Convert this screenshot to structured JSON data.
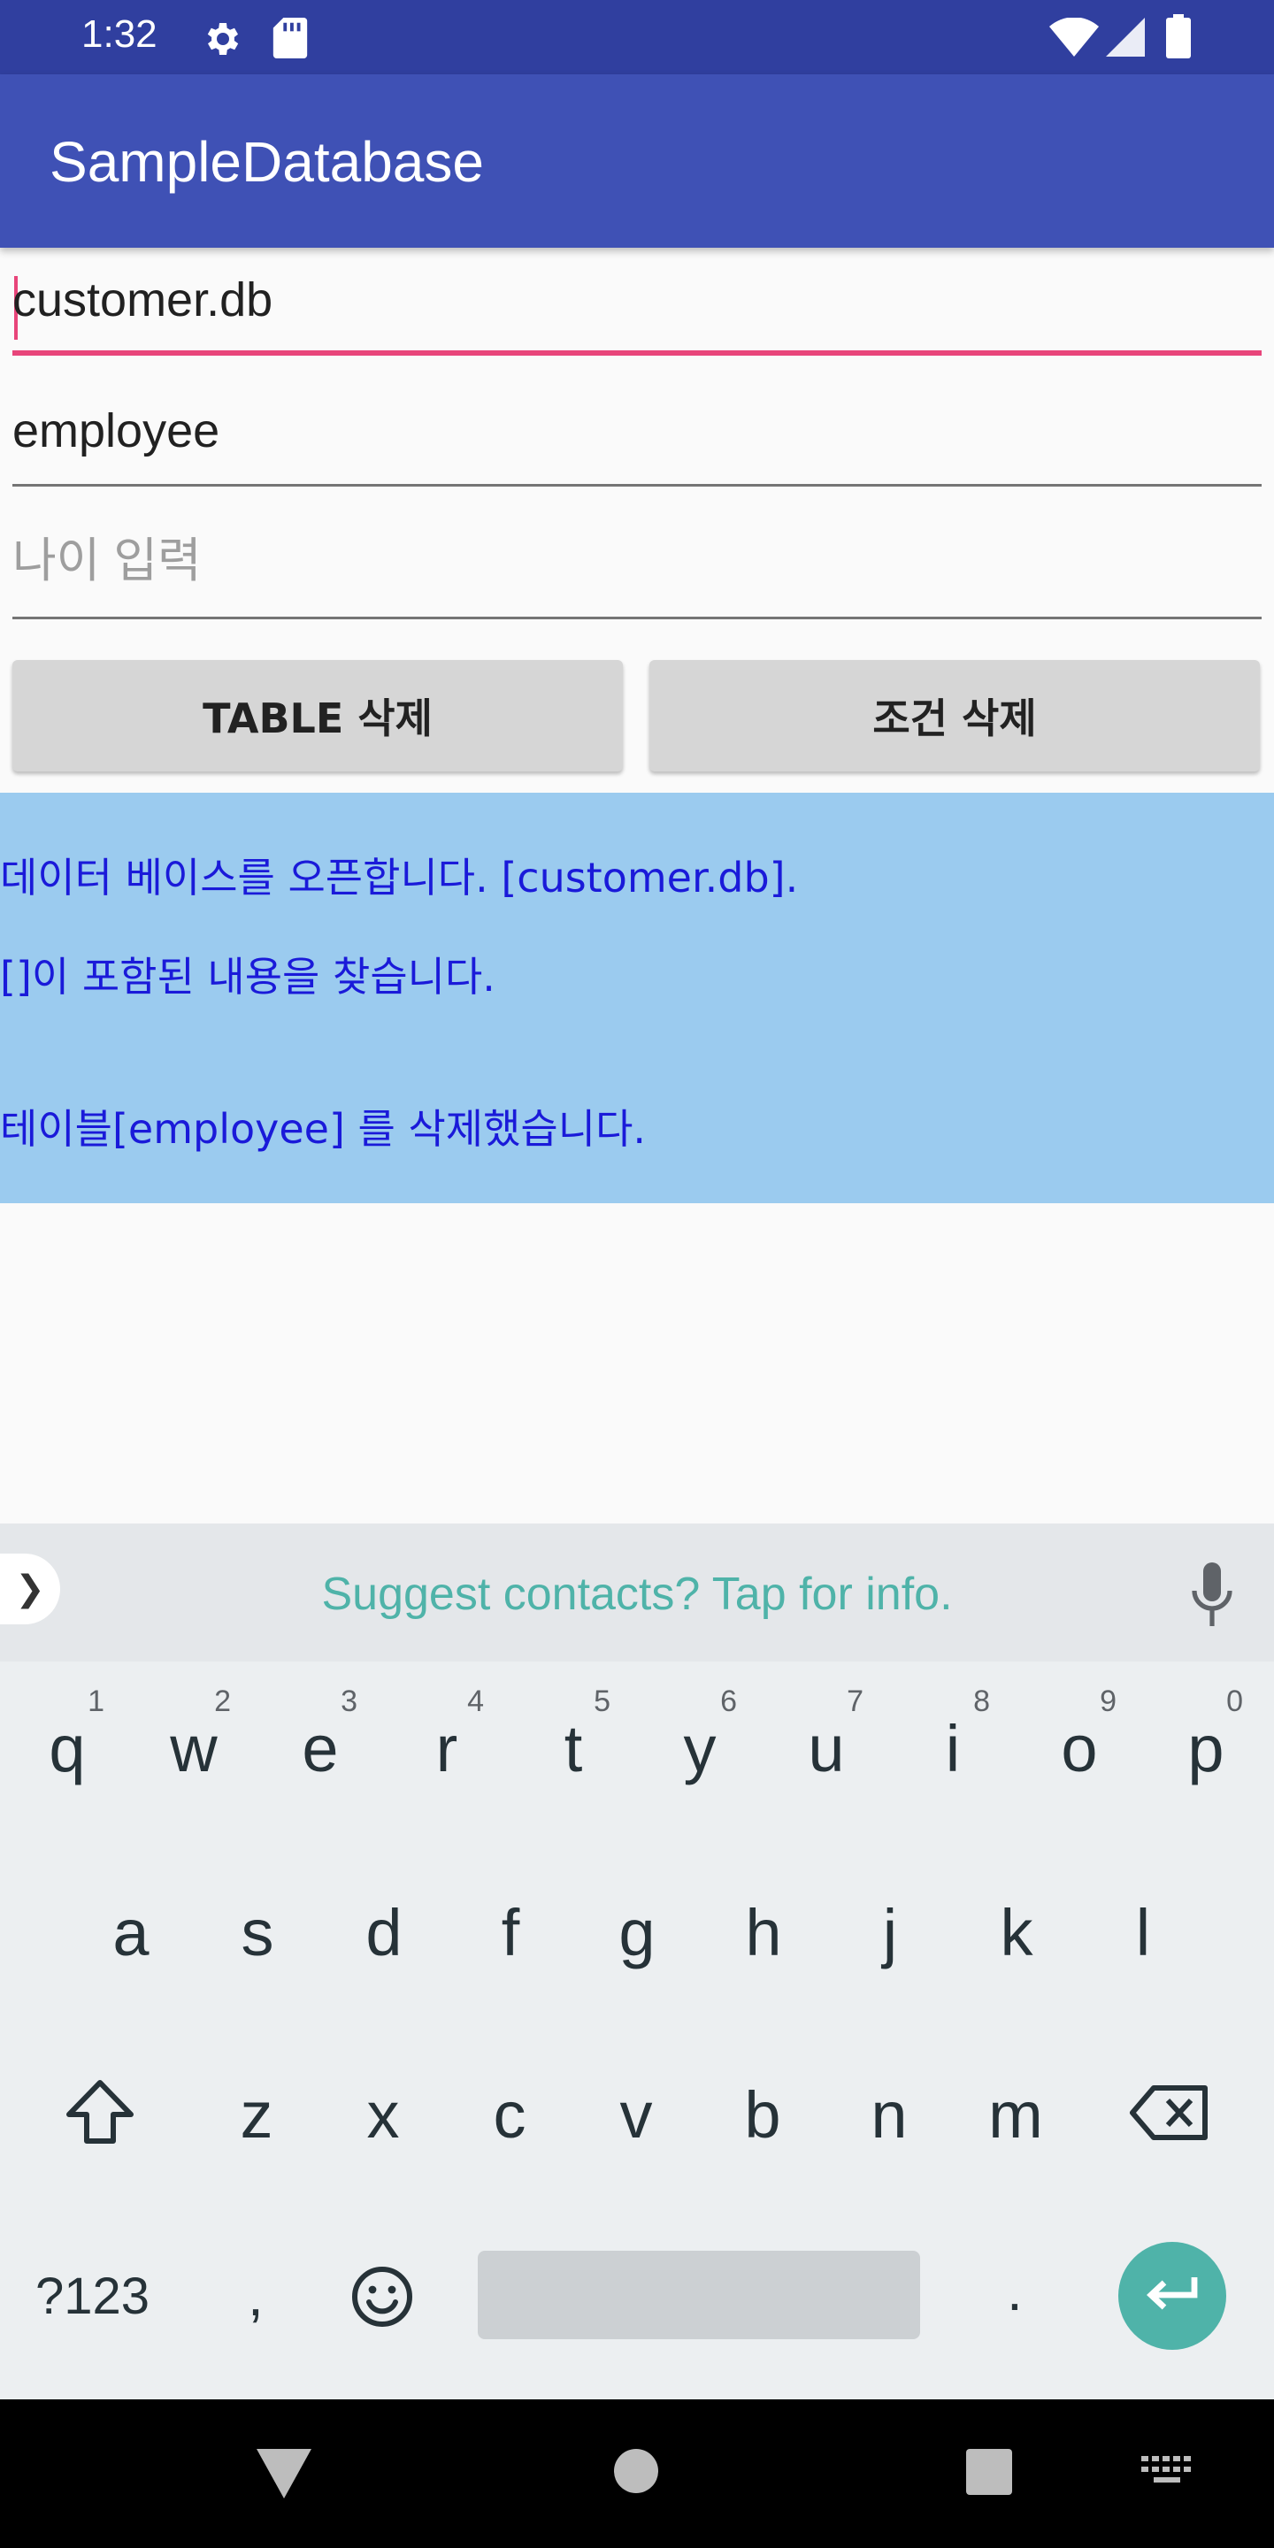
{
  "status_bar": {
    "time": "1:32",
    "icons": [
      "settings-icon",
      "sd-card-icon",
      "wifi-icon",
      "signal-icon",
      "battery-icon"
    ]
  },
  "app_bar": {
    "title": "SampleDatabase"
  },
  "form": {
    "db_field": {
      "value": "customer.db",
      "focused": true
    },
    "table_field": {
      "value": "employee"
    },
    "age_field": {
      "placeholder": "나이 입력"
    }
  },
  "buttons": {
    "table_delete": "TABLE 삭제",
    "condition_delete": "조건 삭제"
  },
  "log": {
    "lines": [
      "데이터 베이스를 오픈합니다. [customer.db].",
      "[]이 포함된 내용을 찾습니다.",
      "테이블[employee] 를 삭제했습니다."
    ]
  },
  "keyboard": {
    "suggestion": "Suggest contacts? Tap for info.",
    "row1": [
      {
        "ch": "q",
        "num": "1"
      },
      {
        "ch": "w",
        "num": "2"
      },
      {
        "ch": "e",
        "num": "3"
      },
      {
        "ch": "r",
        "num": "4"
      },
      {
        "ch": "t",
        "num": "5"
      },
      {
        "ch": "y",
        "num": "6"
      },
      {
        "ch": "u",
        "num": "7"
      },
      {
        "ch": "i",
        "num": "8"
      },
      {
        "ch": "o",
        "num": "9"
      },
      {
        "ch": "p",
        "num": "0"
      }
    ],
    "row2": [
      "a",
      "s",
      "d",
      "f",
      "g",
      "h",
      "j",
      "k",
      "l"
    ],
    "row3": [
      "z",
      "x",
      "c",
      "v",
      "b",
      "n",
      "m"
    ],
    "symbols_key": "?123",
    "comma_key": ",",
    "period_key": "."
  },
  "colors": {
    "status_bar": "#303f9f",
    "app_bar": "#3f51b5",
    "accent": "#e8457a",
    "log_bg": "#9bcbef",
    "log_text": "#1a1ad9",
    "keyboard_accent": "#4fb3a9"
  }
}
